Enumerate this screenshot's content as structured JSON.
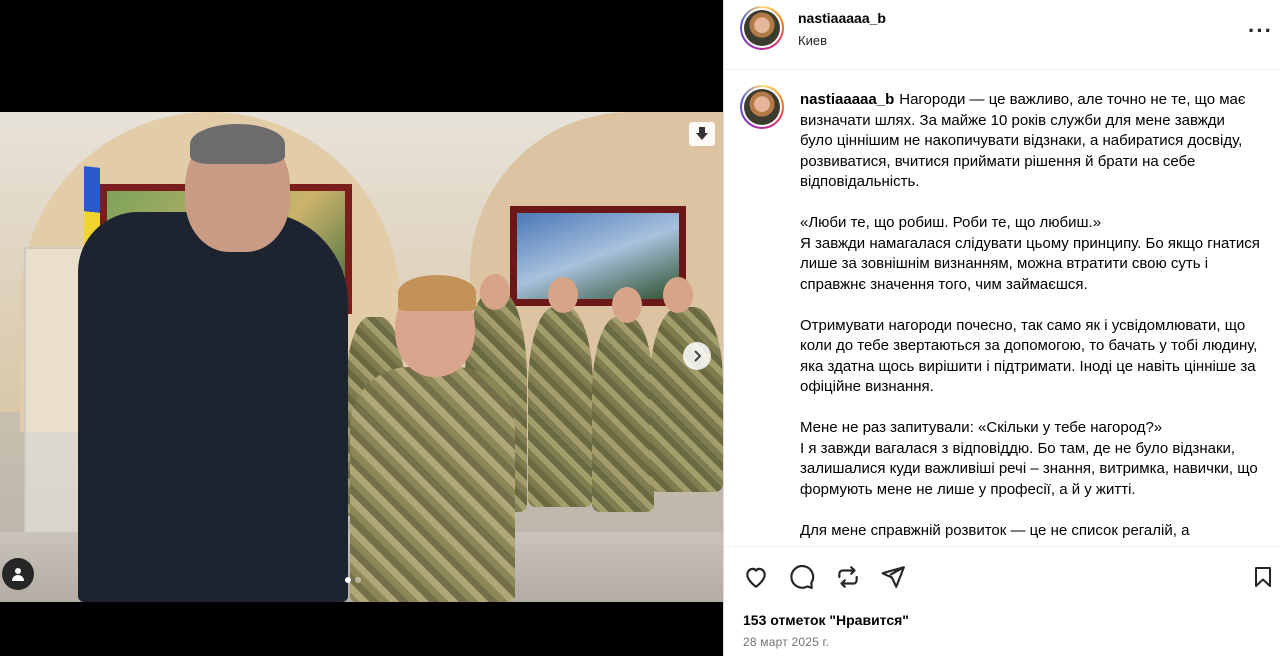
{
  "post": {
    "username": "nastiaaaaa_b",
    "location": "Киев",
    "more_icon": "more-horizontal-icon",
    "caption": {
      "username": "nastiaaaaa_b",
      "p1": "Нагороди — це важливо, але точно не те, що має визначати шлях. За майже 10 років служби для мене завжди було ціннішим не накопичувати відзнаки, а набиратися досвіду, розвиватися, вчитися приймати рішення й брати на себе відповідальність.",
      "p2a": "«Люби те, що робиш. Роби те, що любиш.»",
      "p2b": "Я завжди намагалася слідувати цьому принципу. Бо якщо гнатися лише за зовнішнім визнанням, можна втратити свою суть і справжнє значення того, чим займаєшся.",
      "p3": "Отримувати нагороди почесно, так само як і усвідомлювати, що коли до тебе звертаються за допомогою, то бачать у тобі людину, яка здатна щось вирішити і підтримати. Іноді це навіть цінніше за офіційне визнання.",
      "p4a": "Мене не раз запитували: «Скільки у тебе нагород?»",
      "p4b": "І я завжди вагалася з відповіддю. Бо там, де не було відзнаки, залишалися куди важливіші речі – знання, витримка, навички, що формують мене не лише у професії, а й у житті.",
      "p5": "Для мене справжній розвиток — це не список регалій, а"
    },
    "likes": "153 отметок \"Нравится\"",
    "date": "28 март 2025 г.",
    "carousel": {
      "slides": 2,
      "active": 0
    }
  },
  "icons": {
    "like": "heart-icon",
    "comment": "comment-icon",
    "share": "repost-icon",
    "send": "send-icon",
    "save": "bookmark-icon",
    "download": "download-icon",
    "next": "chevron-right-icon",
    "tag": "user-tag-icon"
  },
  "colors": {
    "background": "#000000",
    "panel": "#ffffff",
    "text": "#000000",
    "secondary_text": "#737373",
    "divider": "#efefef"
  }
}
